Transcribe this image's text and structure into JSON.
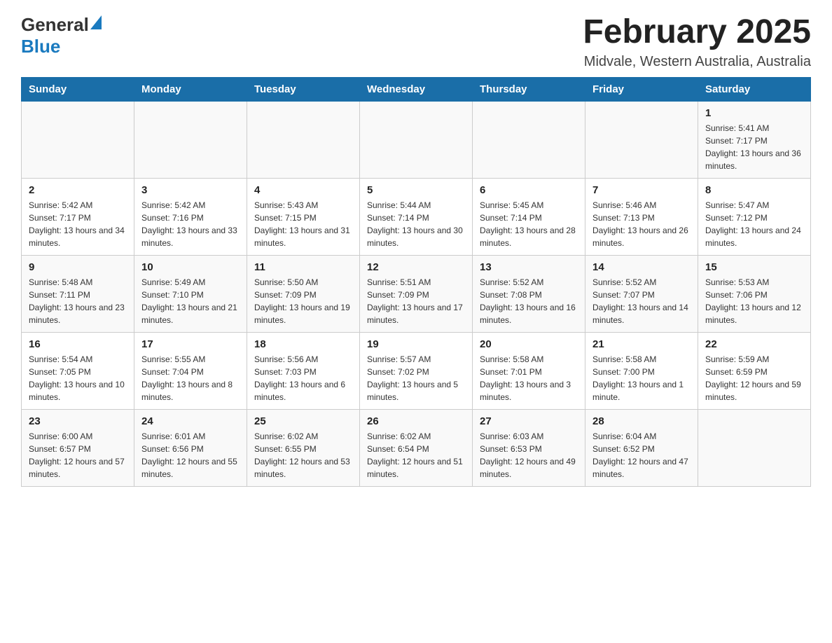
{
  "header": {
    "logo_general": "General",
    "logo_blue": "Blue",
    "title": "February 2025",
    "subtitle": "Midvale, Western Australia, Australia"
  },
  "days_of_week": [
    "Sunday",
    "Monday",
    "Tuesday",
    "Wednesday",
    "Thursday",
    "Friday",
    "Saturday"
  ],
  "weeks": [
    [
      {
        "day": "",
        "info": ""
      },
      {
        "day": "",
        "info": ""
      },
      {
        "day": "",
        "info": ""
      },
      {
        "day": "",
        "info": ""
      },
      {
        "day": "",
        "info": ""
      },
      {
        "day": "",
        "info": ""
      },
      {
        "day": "1",
        "info": "Sunrise: 5:41 AM\nSunset: 7:17 PM\nDaylight: 13 hours and 36 minutes."
      }
    ],
    [
      {
        "day": "2",
        "info": "Sunrise: 5:42 AM\nSunset: 7:17 PM\nDaylight: 13 hours and 34 minutes."
      },
      {
        "day": "3",
        "info": "Sunrise: 5:42 AM\nSunset: 7:16 PM\nDaylight: 13 hours and 33 minutes."
      },
      {
        "day": "4",
        "info": "Sunrise: 5:43 AM\nSunset: 7:15 PM\nDaylight: 13 hours and 31 minutes."
      },
      {
        "day": "5",
        "info": "Sunrise: 5:44 AM\nSunset: 7:14 PM\nDaylight: 13 hours and 30 minutes."
      },
      {
        "day": "6",
        "info": "Sunrise: 5:45 AM\nSunset: 7:14 PM\nDaylight: 13 hours and 28 minutes."
      },
      {
        "day": "7",
        "info": "Sunrise: 5:46 AM\nSunset: 7:13 PM\nDaylight: 13 hours and 26 minutes."
      },
      {
        "day": "8",
        "info": "Sunrise: 5:47 AM\nSunset: 7:12 PM\nDaylight: 13 hours and 24 minutes."
      }
    ],
    [
      {
        "day": "9",
        "info": "Sunrise: 5:48 AM\nSunset: 7:11 PM\nDaylight: 13 hours and 23 minutes."
      },
      {
        "day": "10",
        "info": "Sunrise: 5:49 AM\nSunset: 7:10 PM\nDaylight: 13 hours and 21 minutes."
      },
      {
        "day": "11",
        "info": "Sunrise: 5:50 AM\nSunset: 7:09 PM\nDaylight: 13 hours and 19 minutes."
      },
      {
        "day": "12",
        "info": "Sunrise: 5:51 AM\nSunset: 7:09 PM\nDaylight: 13 hours and 17 minutes."
      },
      {
        "day": "13",
        "info": "Sunrise: 5:52 AM\nSunset: 7:08 PM\nDaylight: 13 hours and 16 minutes."
      },
      {
        "day": "14",
        "info": "Sunrise: 5:52 AM\nSunset: 7:07 PM\nDaylight: 13 hours and 14 minutes."
      },
      {
        "day": "15",
        "info": "Sunrise: 5:53 AM\nSunset: 7:06 PM\nDaylight: 13 hours and 12 minutes."
      }
    ],
    [
      {
        "day": "16",
        "info": "Sunrise: 5:54 AM\nSunset: 7:05 PM\nDaylight: 13 hours and 10 minutes."
      },
      {
        "day": "17",
        "info": "Sunrise: 5:55 AM\nSunset: 7:04 PM\nDaylight: 13 hours and 8 minutes."
      },
      {
        "day": "18",
        "info": "Sunrise: 5:56 AM\nSunset: 7:03 PM\nDaylight: 13 hours and 6 minutes."
      },
      {
        "day": "19",
        "info": "Sunrise: 5:57 AM\nSunset: 7:02 PM\nDaylight: 13 hours and 5 minutes."
      },
      {
        "day": "20",
        "info": "Sunrise: 5:58 AM\nSunset: 7:01 PM\nDaylight: 13 hours and 3 minutes."
      },
      {
        "day": "21",
        "info": "Sunrise: 5:58 AM\nSunset: 7:00 PM\nDaylight: 13 hours and 1 minute."
      },
      {
        "day": "22",
        "info": "Sunrise: 5:59 AM\nSunset: 6:59 PM\nDaylight: 12 hours and 59 minutes."
      }
    ],
    [
      {
        "day": "23",
        "info": "Sunrise: 6:00 AM\nSunset: 6:57 PM\nDaylight: 12 hours and 57 minutes."
      },
      {
        "day": "24",
        "info": "Sunrise: 6:01 AM\nSunset: 6:56 PM\nDaylight: 12 hours and 55 minutes."
      },
      {
        "day": "25",
        "info": "Sunrise: 6:02 AM\nSunset: 6:55 PM\nDaylight: 12 hours and 53 minutes."
      },
      {
        "day": "26",
        "info": "Sunrise: 6:02 AM\nSunset: 6:54 PM\nDaylight: 12 hours and 51 minutes."
      },
      {
        "day": "27",
        "info": "Sunrise: 6:03 AM\nSunset: 6:53 PM\nDaylight: 12 hours and 49 minutes."
      },
      {
        "day": "28",
        "info": "Sunrise: 6:04 AM\nSunset: 6:52 PM\nDaylight: 12 hours and 47 minutes."
      },
      {
        "day": "",
        "info": ""
      }
    ]
  ]
}
